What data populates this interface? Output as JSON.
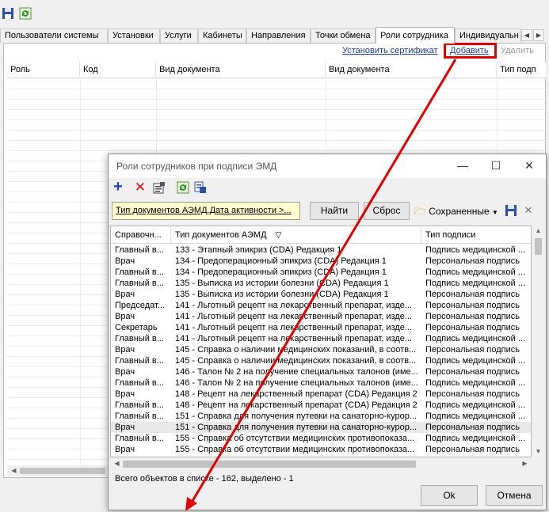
{
  "main": {
    "tabs": [
      {
        "label": "Пользователи системы",
        "active": false
      },
      {
        "label": "Установки",
        "active": false
      },
      {
        "label": "Услуги",
        "active": false
      },
      {
        "label": "Кабинеты",
        "active": false
      },
      {
        "label": "Направления",
        "active": false
      },
      {
        "label": "Точки обмена",
        "active": false
      },
      {
        "label": "Роли сотрудника",
        "active": true
      },
      {
        "label": "Индивидуальн",
        "active": false
      }
    ],
    "links": {
      "install_cert": "Установить сертификат",
      "add": "Добавить",
      "delete": "Удалить"
    },
    "columns": [
      "Роль",
      "Код",
      "Вид документа",
      "Вид документа",
      "Тип подп"
    ]
  },
  "dialog": {
    "title": "Роли сотрудников при подписи ЭМД",
    "filter_text": "Тип документов АЭМД.Дата активности >...",
    "find_label": "Найти",
    "reset_label": "Сброс",
    "saved_label": "Сохраненные",
    "columns": [
      "Справочн...",
      "Тип документов АЭМД",
      "Тип подписи"
    ],
    "rows": [
      [
        "Главный в...",
        "133 - Этапный эпикриз (CDA) Редакция 1",
        "Подпись медицинской ..."
      ],
      [
        "Врач",
        "134 - Предоперационный эпикриз (CDA) Редакция 1",
        "Персональная подпись"
      ],
      [
        "Главный в...",
        "134 - Предоперационный эпикриз (CDA) Редакция 1",
        "Подпись медицинской ..."
      ],
      [
        "Главный в...",
        "135 - Выписка из истории болезни (CDA) Редакция 1",
        "Подпись медицинской ..."
      ],
      [
        "Врач",
        "135 - Выписка из истории болезни (CDA) Редакция 1",
        "Персональная подпись"
      ],
      [
        "Председат...",
        "141 - Льготный рецепт на лекарственный препарат, изде...",
        "Персональная подпись"
      ],
      [
        "Врач",
        "141 - Льготный рецепт на лекарственный препарат, изде...",
        "Персональная подпись"
      ],
      [
        "Секретарь",
        "141 - Льготный рецепт на лекарственный препарат, изде...",
        "Персональная подпись"
      ],
      [
        "Главный в...",
        "141 - Льготный рецепт на лекарственный препарат, изде...",
        "Подпись медицинской ..."
      ],
      [
        "Врач",
        "145 - Справка о наличии медицинских показаний, в соотв...",
        "Персональная подпись"
      ],
      [
        "Главный в...",
        "145 - Справка о наличии медицинских показаний, в соотв...",
        "Подпись медицинской ..."
      ],
      [
        "Врач",
        "146 - Талон № 2 на получение специальных талонов (име...",
        "Персональная подпись"
      ],
      [
        "Главный в...",
        "146 - Талон № 2 на получение специальных талонов (име...",
        "Подпись медицинской ..."
      ],
      [
        "Врач",
        "148 - Рецепт на лекарственный препарат (CDA) Редакция 2",
        "Персональная подпись"
      ],
      [
        "Главный в...",
        "148 - Рецепт на лекарственный препарат (CDA) Редакция 2",
        "Подпись медицинской ..."
      ],
      [
        "Главный в...",
        "151 - Справка для получения путевки на санаторно-курор...",
        "Подпись медицинской ..."
      ],
      [
        "Врач",
        "151 - Справка для получения путевки на санаторно-курор...",
        "Персональная подпись"
      ],
      [
        "Главный в...",
        "155 - Справка об отсутствии медицинских противопоказа...",
        "Подпись медицинской ..."
      ],
      [
        "Врач",
        "155 - Справка об отсутствии медицинских противопоказа...",
        "Персональная подпись"
      ]
    ],
    "selected_row": 16,
    "status": "Всего объектов в списке - 162, выделено - 1",
    "ok_label": "Ok",
    "cancel_label": "Отмена"
  },
  "colors": {
    "link": "#1a3ea3",
    "annotation": "#e30000",
    "filter_bg": "#ffffd0"
  },
  "icons": {
    "toolbar_main": [
      "save-icon",
      "refresh-icon"
    ],
    "toolbar_dialog": [
      "add-icon",
      "delete-icon",
      "properties-icon",
      "refresh-icon",
      "export-icon"
    ]
  }
}
